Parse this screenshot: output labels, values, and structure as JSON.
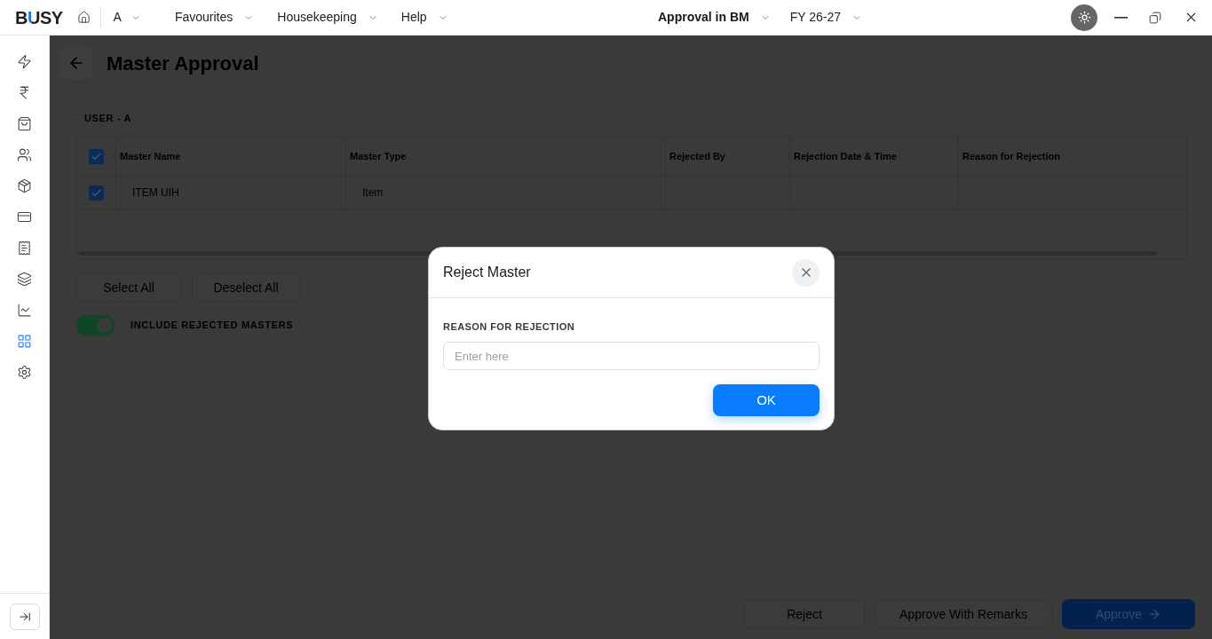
{
  "top_bar": {
    "logo": "BUSY",
    "company": {
      "label": "A"
    },
    "menus": [
      {
        "label": "Favourites"
      },
      {
        "label": "Housekeeping"
      },
      {
        "label": "Help"
      }
    ],
    "context": {
      "label": "Approval in BM"
    },
    "year": {
      "label": "FY 26-27"
    }
  },
  "sidebar": {
    "items": [
      {
        "selected": false
      },
      {
        "selected": false
      },
      {
        "selected": false
      },
      {
        "selected": false
      },
      {
        "selected": false
      },
      {
        "selected": false
      },
      {
        "selected": false
      },
      {
        "selected": false
      },
      {
        "selected": false
      },
      {
        "selected": true
      },
      {
        "selected": false
      }
    ]
  },
  "page": {
    "title": "Master Approval",
    "user_label": "USER - A",
    "table": {
      "all_checked": true,
      "columns": [
        "Master Name",
        "Master Type",
        "Rejected By",
        "Rejection Date & Time",
        "Reason for Rejection"
      ],
      "rows": [
        {
          "checked": true,
          "master_name": "ITEM UIH",
          "master_type": "Item"
        }
      ]
    },
    "actions": [
      "Select All",
      "Deselect All"
    ],
    "toggle": {
      "label": "INCLUDE REJECTED MASTERS",
      "on": true
    }
  },
  "footer": {
    "buttons": [
      {
        "label": "Reject",
        "kind": "secondary"
      },
      {
        "label": "Approve With Remarks",
        "kind": "secondary"
      },
      {
        "label": "Approve",
        "kind": "primary"
      }
    ]
  },
  "dialog": {
    "title": "Reject Master",
    "field": {
      "label": "REASON FOR REJECTION",
      "placeholder": "Enter here"
    },
    "ok_button": "OK"
  }
}
